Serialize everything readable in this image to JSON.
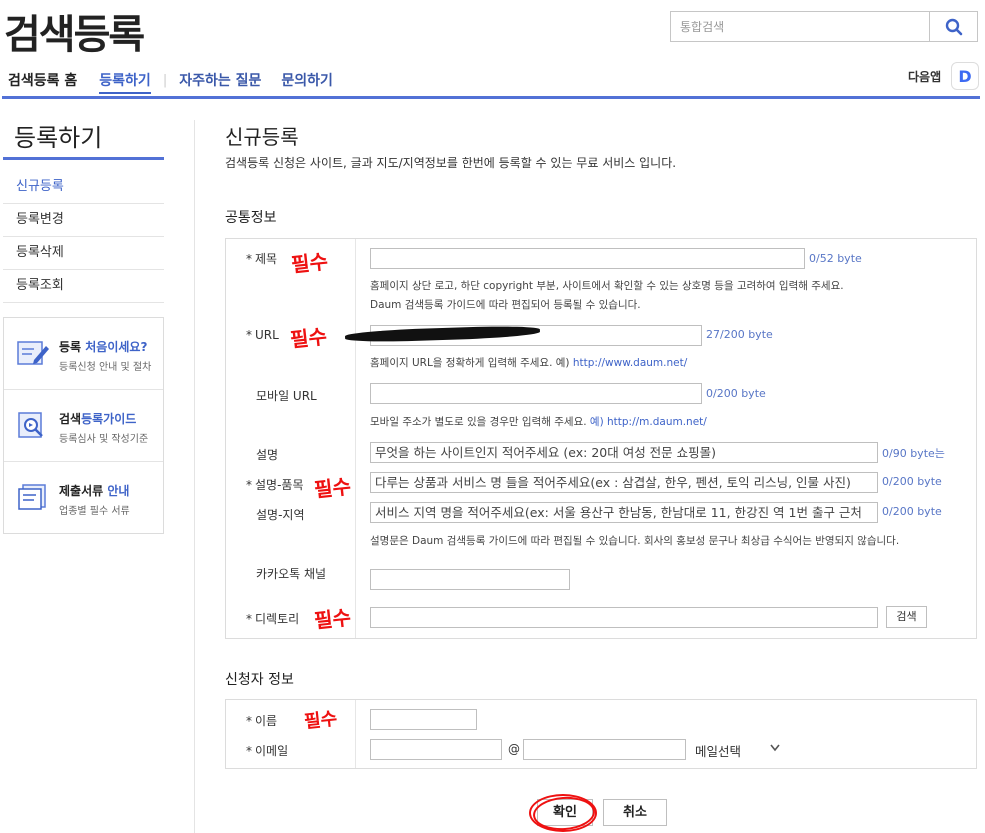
{
  "header": {
    "logo": "검색등록",
    "search_placeholder": "통합검색",
    "nav_home": "검색등록 홈",
    "nav_active": "등록하기",
    "nav_faq": "자주하는 질문",
    "nav_contact": "문의하기",
    "daum_app": "다음앱",
    "daum_logo_letter": "D"
  },
  "sidebar": {
    "title": "등록하기",
    "items": [
      {
        "label": "신규등록"
      },
      {
        "label": "등록변경"
      },
      {
        "label": "등록삭제"
      },
      {
        "label": "등록조회"
      }
    ],
    "cards": [
      {
        "title_a": "등록 ",
        "title_b": "처음이세요?",
        "sub": "등록신청 안내 및 절차",
        "icon": "pencil-doc-icon"
      },
      {
        "title_a": "검색",
        "title_b": "등록가이드",
        "sub": "등록심사 및 작성기준",
        "icon": "magnifier-doc-icon"
      },
      {
        "title_a": "제출서류 ",
        "title_b": "안내",
        "sub": "업종별 필수 서류",
        "icon": "document-stack-icon"
      }
    ]
  },
  "main": {
    "title": "신규등록",
    "desc": "검색등록 신청은 사이트, 글과 지도/지역정보를 한번에 등록할 수 있는 무료 서비스 입니다.",
    "common_section": "공통정보",
    "applicant_section": "신청자 정보",
    "fields": {
      "title_label": "제목",
      "title_byte": "0/52 byte",
      "title_help1": "홈페이지 상단 로고, 하단 copyright 부분, 사이트에서 확인할 수 있는 상호명 등을 고려하여 입력해 주세요.",
      "title_help2": "Daum 검색등록 가이드에 따라 편집되어 등록될 수 있습니다.",
      "url_label": "URL",
      "url_byte": "27/200 byte",
      "url_help": "홈페이지 URL을 정확하게 입력해 주세요. 예) ",
      "url_example": "http://www.daum.net/",
      "mobile_label": "모바일 URL",
      "mobile_byte": "0/200 byte",
      "mobile_help": "모바일 주소가 별도로 있을 경우만 입력해 주세요. ",
      "mobile_example": "예) http://m.daum.net/",
      "desc_label": "설명",
      "desc_value": "무엇을 하는 사이트인지 적어주세요 (ex: 20대 여성 전문 쇼핑몰)",
      "desc_byte": "0/90 byte는",
      "desc_product_label": "설명-품목",
      "desc_product_value": "다루는 상품과 서비스 명 들을 적어주세요(ex : 삼겹살, 한우, 펜션, 토익 리스닝, 인물 사진)",
      "desc_product_byte": "0/200 byte",
      "desc_region_label": "설명-지역",
      "desc_region_value": "서비스 지역 명을 적어주세요(ex: 서울  용산구 한남동, 한남대로 11, 한강진 역 1번 출구 근처",
      "desc_region_byte": "0/200 byte",
      "desc_help": "설명문은 Daum 검색등록 가이드에 따라 편집될 수 있습니다. 회사의 홍보성 문구나 최상급 수식어는 반영되지 않습니다.",
      "kakao_label": "카카오톡 채널",
      "dir_label": "디렉토리",
      "dir_button": "검색",
      "name_label": "이름",
      "email_label": "이메일",
      "email_at": "@",
      "email_select": "메일선택",
      "required_mark": "*"
    },
    "handwriting": {
      "required": "필수"
    },
    "buttons": {
      "confirm": "확인",
      "cancel": "취소"
    }
  }
}
